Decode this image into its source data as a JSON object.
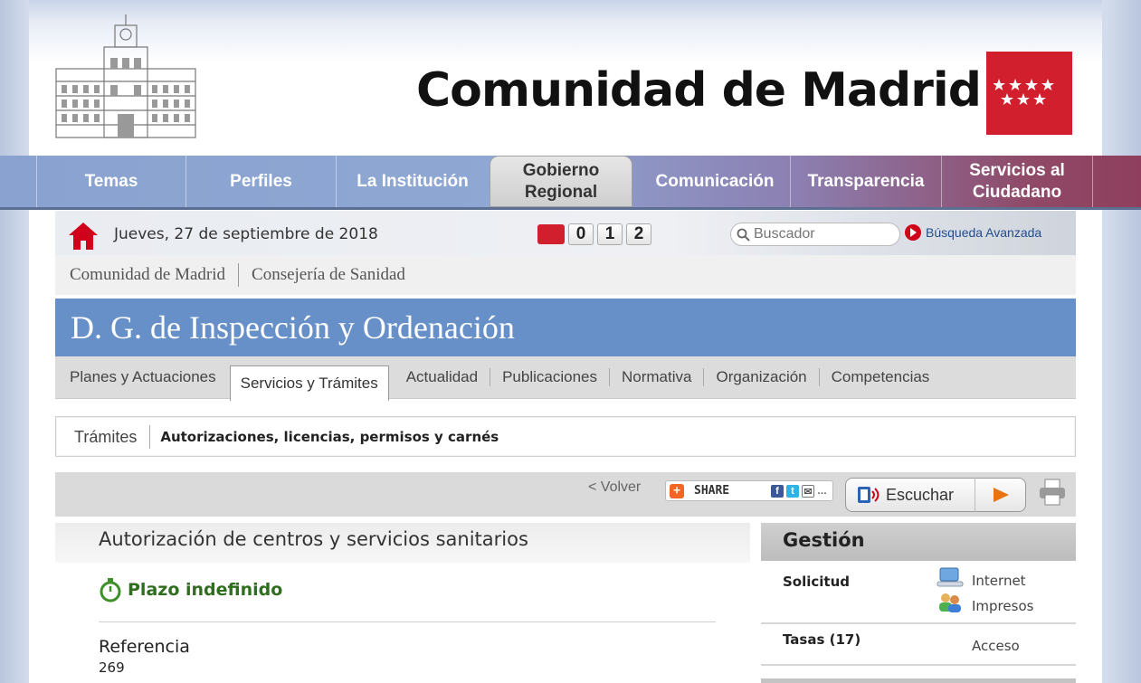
{
  "brand": {
    "title": "Comunidad de Madrid"
  },
  "mainnav": {
    "items": [
      {
        "label": "Temas"
      },
      {
        "label": "Perfiles"
      },
      {
        "label": "La Institución"
      },
      {
        "label": "Gobierno Regional",
        "active": true
      },
      {
        "label": "Comunicación"
      },
      {
        "label": "Transparencia"
      },
      {
        "label": "Servicios al Ciudadano"
      }
    ]
  },
  "utility": {
    "date": "Jueves, 27 de septiembre de 2018",
    "phone_digits": [
      "0",
      "1",
      "2"
    ],
    "search_placeholder": "Buscador",
    "advanced_search": "Búsqueda Avanzada"
  },
  "breadcrumb": [
    "Comunidad de Madrid",
    "Consejería de Sanidad"
  ],
  "section": {
    "title": "D. G. de Inspección y Ordenación",
    "tabs": [
      {
        "label": "Planes y Actuaciones"
      },
      {
        "label": "Servicios y Trámites",
        "active": true
      },
      {
        "label": "Actualidad"
      },
      {
        "label": "Publicaciones"
      },
      {
        "label": "Normativa"
      },
      {
        "label": "Organización"
      },
      {
        "label": "Competencias"
      }
    ]
  },
  "subsection": {
    "tab": "Trámites",
    "current": "Autorizaciones, licencias, permisos y carnés"
  },
  "toolbar": {
    "back": "< Volver",
    "share": "SHARE",
    "listen": "Escuchar"
  },
  "content": {
    "title": "Autorización de centros y servicios sanitarios",
    "deadline": "Plazo indefinido",
    "reference_label": "Referencia",
    "reference_value": "269"
  },
  "gestion": {
    "title": "Gestión",
    "solicitud_label": "Solicitud",
    "internet_link": "Internet",
    "impresos_link": "Impresos",
    "tasas_label": "Tasas (17)",
    "acceso_link": "Acceso"
  },
  "colors": {
    "brand_red": "#d21f2d",
    "title_band": "#6690c7",
    "deadline_green": "#2f6e1f"
  }
}
